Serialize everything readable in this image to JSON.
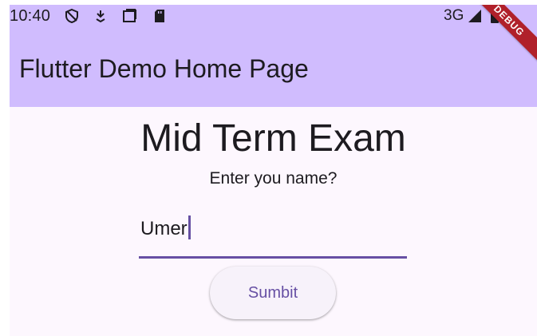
{
  "status_bar": {
    "time": "10:40",
    "network": "3G",
    "icons": [
      "shield-icon",
      "download-icon",
      "square-icon",
      "sd-card-icon",
      "signal-icon",
      "battery-icon"
    ]
  },
  "app_bar": {
    "title": "Flutter Demo Home Page",
    "color": "#d0bcfe"
  },
  "debug_banner": {
    "label": "DEBUG"
  },
  "body": {
    "heading": "Mid Term Exam",
    "prompt": "Enter you name?",
    "name_input": {
      "value": "Umer"
    },
    "submit_button": {
      "label": "Sumbit"
    }
  },
  "colors": {
    "primary": "#6750a4",
    "background": "#fdf7fe"
  }
}
